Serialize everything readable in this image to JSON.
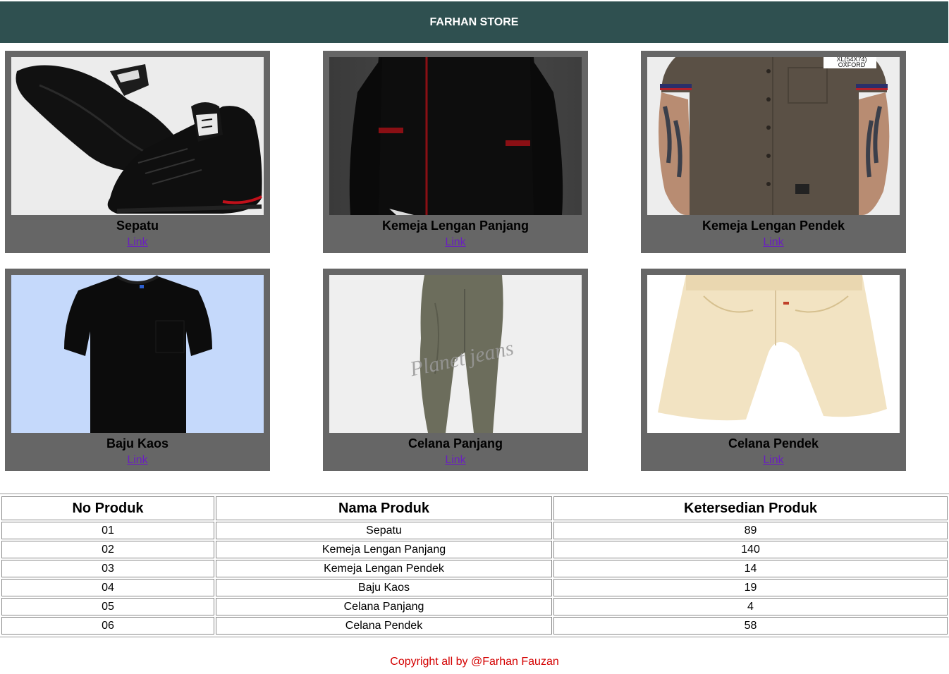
{
  "header": {
    "title": "FARHAN STORE"
  },
  "products": [
    {
      "name": "Sepatu",
      "link": "Link"
    },
    {
      "name": "Kemeja Lengan Panjang",
      "link": "Link"
    },
    {
      "name": "Kemeja Lengan Pendek",
      "link": "Link"
    },
    {
      "name": "Baju Kaos",
      "link": "Link"
    },
    {
      "name": "Celana Panjang",
      "link": "Link"
    },
    {
      "name": "Celana Pendek",
      "link": "Link"
    }
  ],
  "image_text": {
    "oxford_size": "XL(54X74)",
    "oxford_label": "OXFORD",
    "watermark": "Planet jeans"
  },
  "table": {
    "headers": [
      "No Produk",
      "Nama Produk",
      "Ketersedian Produk"
    ],
    "rows": [
      [
        "01",
        "Sepatu",
        "89"
      ],
      [
        "02",
        "Kemeja Lengan Panjang",
        "140"
      ],
      [
        "03",
        "Kemeja Lengan Pendek",
        "14"
      ],
      [
        "04",
        "Baju Kaos",
        "19"
      ],
      [
        "05",
        "Celana Panjang",
        "4"
      ],
      [
        "06",
        "Celana Pendek",
        "58"
      ]
    ]
  },
  "footer": {
    "text": "Copyright all by @Farhan Fauzan"
  },
  "colors": {
    "header_bg": "#2f5050",
    "card_bg": "#666666",
    "link": "#6a1fbf",
    "footer_text": "#d40000"
  }
}
